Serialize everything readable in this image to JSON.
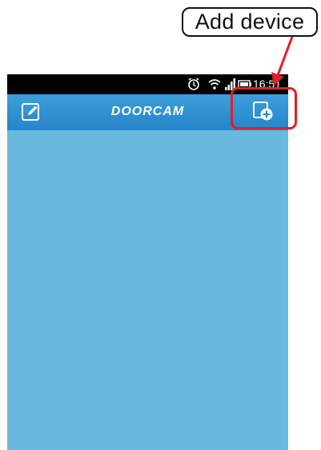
{
  "annotation": {
    "callout_label": "Add device"
  },
  "status_bar": {
    "time": "16:51",
    "icons": [
      "alarm-icon",
      "wifi-icon",
      "signal-icon",
      "battery-icon"
    ]
  },
  "toolbar": {
    "title": "DOORCAM",
    "left_action_icon": "edit-icon",
    "right_action_icon": "add-device-icon"
  },
  "colors": {
    "toolbar": "#2e8fd1",
    "content_background": "#6ab8e0",
    "highlight": "#e41e26"
  }
}
